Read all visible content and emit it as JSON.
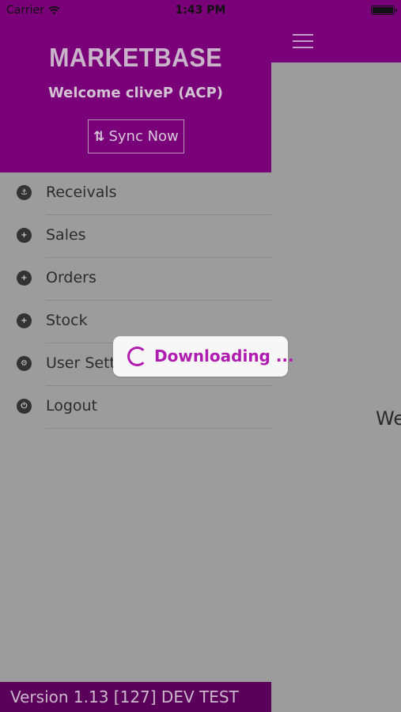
{
  "status_bar": {
    "carrier": "Carrier",
    "time": "1:43 PM",
    "wifi_icon": "wifi-icon",
    "battery_icon": "battery-icon"
  },
  "colors": {
    "brand_purple": "#7a007a",
    "version_bar": "#5a005a",
    "accent": "#b01bb0",
    "overlay_gray": "#9c9c9c"
  },
  "drawer": {
    "brand": "MARKETBASE",
    "welcome": "Welcome cliveP (ACP)",
    "sync_label": "Sync Now",
    "sync_icon": "sync-arrows-icon",
    "menu": [
      {
        "label": "Receivals",
        "icon": "anchor-icon"
      },
      {
        "label": "Sales",
        "icon": "plus-circle-icon"
      },
      {
        "label": "Orders",
        "icon": "plus-circle-icon"
      },
      {
        "label": "Stock",
        "icon": "plus-circle-icon"
      },
      {
        "label": "User Settings",
        "icon": "gear-icon"
      },
      {
        "label": "Logout",
        "icon": "power-icon"
      }
    ],
    "version": "Version 1.13 [127] DEV TEST"
  },
  "main": {
    "menu_icon": "hamburger-icon",
    "partial_text": "We"
  },
  "toast": {
    "text": "Downloading ...",
    "icon": "spinner-icon"
  }
}
